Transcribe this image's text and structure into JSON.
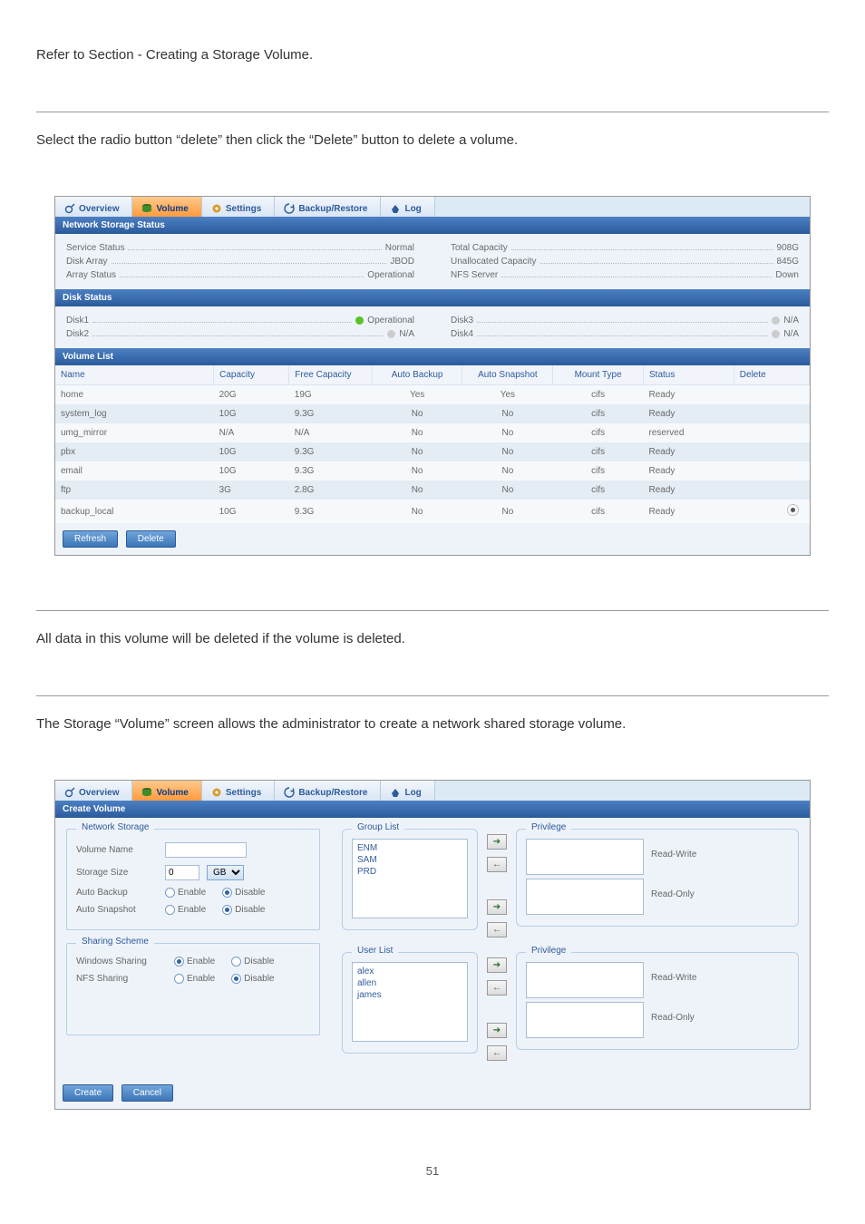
{
  "text": {
    "intro": "Refer to Section - Creating a Storage Volume.",
    "deleteInstr": "Select the radio button “delete” then click the “Delete” button to delete a volume.",
    "warning": "All data in this volume will be deleted if the volume is deleted.",
    "createIntro": "The Storage “Volume” screen allows the administrator to create a network shared storage volume.",
    "pageNo": "51"
  },
  "tabs": {
    "overview": "Overview",
    "volume": "Volume",
    "settings": "Settings",
    "backup": "Backup/Restore",
    "log": "Log"
  },
  "netStorage": {
    "header": "Network Storage Status",
    "serviceStatusLabel": "Service Status",
    "serviceStatus": "Normal",
    "diskArrayLabel": "Disk Array",
    "diskArray": "JBOD",
    "arrayStatusLabel": "Array Status",
    "arrayStatus": "Operational",
    "totalCapLabel": "Total Capacity",
    "totalCap": "908G",
    "unallocLabel": "Unallocated Capacity",
    "unalloc": "845G",
    "nfsLabel": "NFS Server",
    "nfs": "Down"
  },
  "diskStatus": {
    "header": "Disk Status",
    "d1Label": "Disk1",
    "d1": "Operational",
    "d2Label": "Disk2",
    "d2": "N/A",
    "d3Label": "Disk3",
    "d3": "N/A",
    "d4Label": "Disk4",
    "d4": "N/A"
  },
  "volList": {
    "header": "Volume List",
    "cols": {
      "name": "Name",
      "cap": "Capacity",
      "free": "Free Capacity",
      "ab": "Auto Backup",
      "as": "Auto Snapshot",
      "mt": "Mount Type",
      "st": "Status",
      "del": "Delete"
    },
    "rows": [
      {
        "name": "home",
        "cap": "20G",
        "free": "19G",
        "ab": "Yes",
        "as": "Yes",
        "mt": "cifs",
        "st": "Ready"
      },
      {
        "name": "system_log",
        "cap": "10G",
        "free": "9.3G",
        "ab": "No",
        "as": "No",
        "mt": "cifs",
        "st": "Ready"
      },
      {
        "name": "umg_mirror",
        "cap": "N/A",
        "free": "N/A",
        "ab": "No",
        "as": "No",
        "mt": "cifs",
        "st": "reserved"
      },
      {
        "name": "pbx",
        "cap": "10G",
        "free": "9.3G",
        "ab": "No",
        "as": "No",
        "mt": "cifs",
        "st": "Ready"
      },
      {
        "name": "email",
        "cap": "10G",
        "free": "9.3G",
        "ab": "No",
        "as": "No",
        "mt": "cifs",
        "st": "Ready"
      },
      {
        "name": "ftp",
        "cap": "3G",
        "free": "2.8G",
        "ab": "No",
        "as": "No",
        "mt": "cifs",
        "st": "Ready"
      },
      {
        "name": "backup_local",
        "cap": "10G",
        "free": "9.3G",
        "ab": "No",
        "as": "No",
        "mt": "cifs",
        "st": "Ready",
        "radio": true
      }
    ],
    "buttons": {
      "refresh": "Refresh",
      "delete": "Delete"
    }
  },
  "createVol": {
    "header": "Create Volume",
    "legends": {
      "ns": "Network Storage",
      "ss": "Sharing Scheme",
      "gl": "Group List",
      "ul": "User List",
      "priv": "Privilege"
    },
    "labels": {
      "vname": "Volume Name",
      "ssize": "Storage Size",
      "abackup": "Auto Backup",
      "asnap": "Auto Snapshot",
      "wshare": "Windows Sharing",
      "nfs": "NFS Sharing",
      "enable": "Enable",
      "disable": "Disable",
      "rw": "Read-Write",
      "ro": "Read-Only",
      "gb": "GB"
    },
    "values": {
      "ssize": "0"
    },
    "groups": [
      "ENM",
      "SAM",
      "PRD"
    ],
    "users": [
      "alex",
      "allen",
      "james"
    ],
    "buttons": {
      "create": "Create",
      "cancel": "Cancel"
    }
  }
}
